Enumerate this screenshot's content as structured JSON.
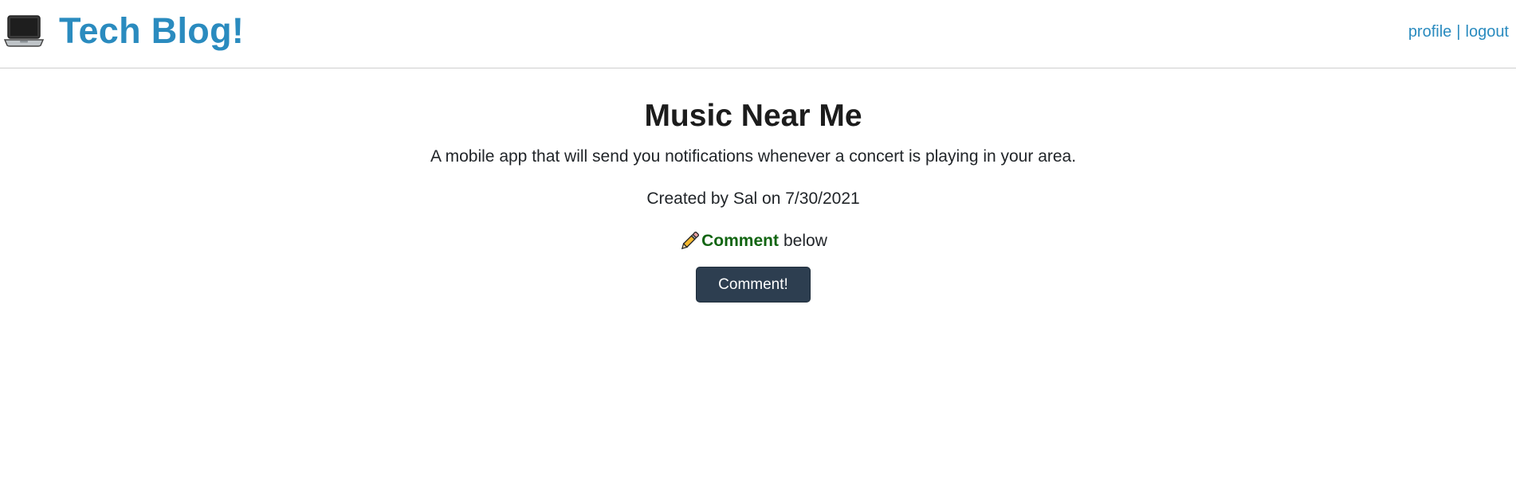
{
  "header": {
    "brand_title": "Tech Blog!",
    "brand_icon": "laptop-icon",
    "nav": {
      "profile_label": "profile",
      "separator": "|",
      "logout_label": "logout"
    }
  },
  "post": {
    "title": "Music Near Me",
    "body": "A mobile app that will send you notifications whenever a concert is playing in your area.",
    "meta": "Created by Sal on 7/30/2021",
    "comment_hint": {
      "icon": "pencil-icon",
      "strong": "Comment",
      "rest": "below"
    },
    "comment_button_label": "Comment!"
  },
  "colors": {
    "brand": "#2a8bbf",
    "comment_strong": "#126512",
    "button_bg": "#2d3e50"
  }
}
